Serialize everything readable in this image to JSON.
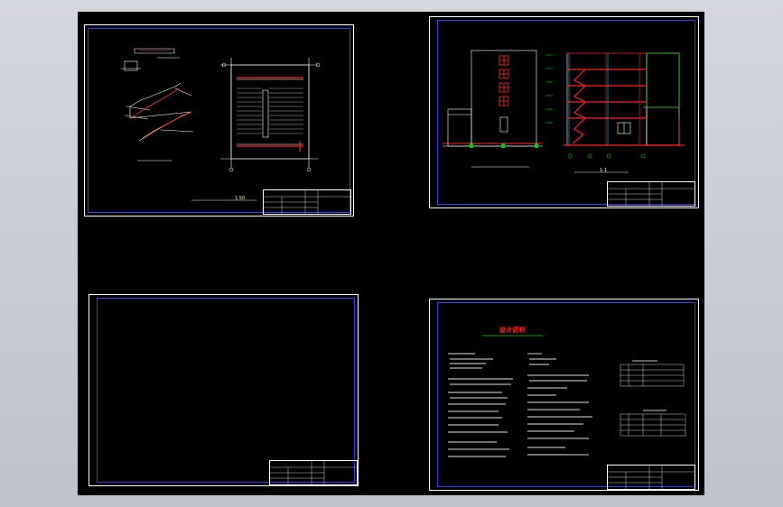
{
  "colors": {
    "background": "#000000",
    "frame_outer": "#ffffff",
    "frame_inner": "#3a3aff",
    "red_lines": "#ff1e1e",
    "green_lines": "#00d000",
    "cyan_lines": "#00d8ff",
    "yellow_lines": "#ffff55",
    "chrome": "#c9cdd1"
  },
  "sheets": [
    {
      "id": "sheet-1",
      "content": "stair-details",
      "caption": " ",
      "scale": "1:50"
    },
    {
      "id": "sheet-2",
      "content": "elevation-and-section",
      "caption_left": "",
      "caption_right": "1-1"
    },
    {
      "id": "sheet-3",
      "content": "blank"
    },
    {
      "id": "sheet-4",
      "content": "design-notes",
      "title": "设计说明"
    }
  ]
}
